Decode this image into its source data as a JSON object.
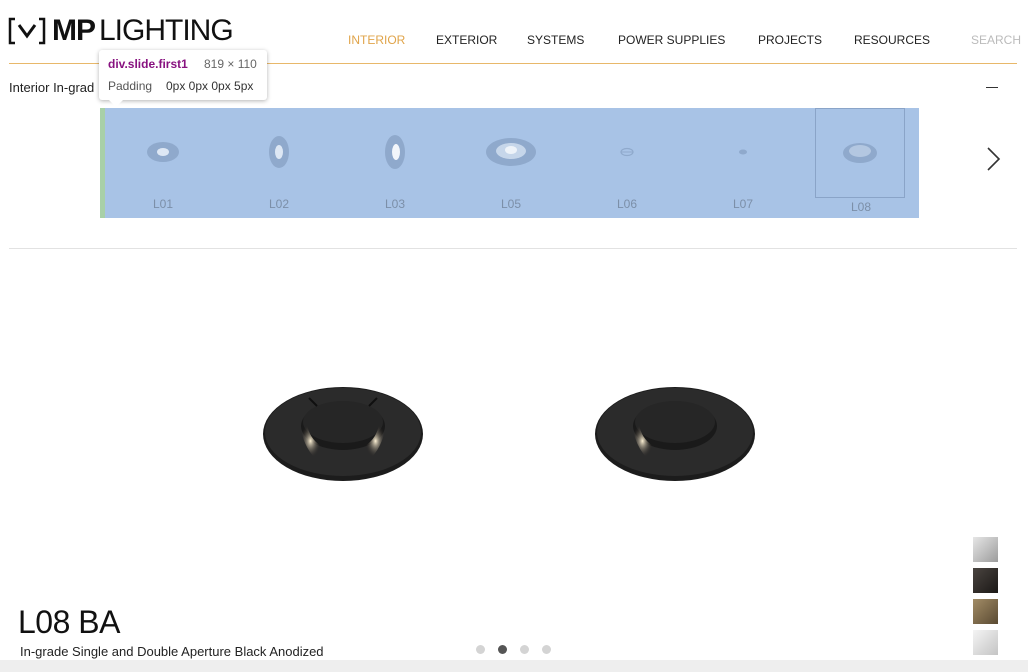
{
  "brand": {
    "logo_bold": "MP",
    "logo_light": "LIGHTING"
  },
  "nav": {
    "items": [
      {
        "label": "INTERIOR",
        "active": true
      },
      {
        "label": "EXTERIOR",
        "active": false
      },
      {
        "label": "SYSTEMS",
        "active": false
      },
      {
        "label": "POWER SUPPLIES",
        "active": false
      },
      {
        "label": "PROJECTS",
        "active": false
      },
      {
        "label": "RESOURCES",
        "active": false
      }
    ],
    "search_label": "SEARCH"
  },
  "breadcrumb": "Interior In-grad",
  "thumbnails": [
    {
      "label": "L01",
      "shape": "disc-flat",
      "selected": false
    },
    {
      "label": "L02",
      "shape": "disc-tall",
      "selected": false
    },
    {
      "label": "L03",
      "shape": "disc-tall-bright",
      "selected": false
    },
    {
      "label": "L05",
      "shape": "disc-wide",
      "selected": false
    },
    {
      "label": "L06",
      "shape": "mini",
      "selected": false
    },
    {
      "label": "L07",
      "shape": "mini-dot",
      "selected": false
    },
    {
      "label": "L08",
      "shape": "disc-flat",
      "selected": true
    }
  ],
  "product": {
    "code": "L08",
    "finish": "BA",
    "description": "In-grade Single and Double Aperture Black Anodized"
  },
  "swatches": [
    {
      "name": "silver",
      "color": "#b9b9b9"
    },
    {
      "name": "black",
      "color": "#2a2622"
    },
    {
      "name": "bronze",
      "color": "#7d6a4d"
    },
    {
      "name": "white",
      "color": "#d9d9d9"
    }
  ],
  "carousel": {
    "count": 4,
    "active": 1
  },
  "devtools_tooltip": {
    "selector": "div.slide.first1",
    "size": "819 × 110",
    "padding_label": "Padding",
    "padding_value": "0px 0px 0px 5px"
  },
  "colors": {
    "accent": "#e0a44a",
    "highlight": "#a8c3e6"
  }
}
